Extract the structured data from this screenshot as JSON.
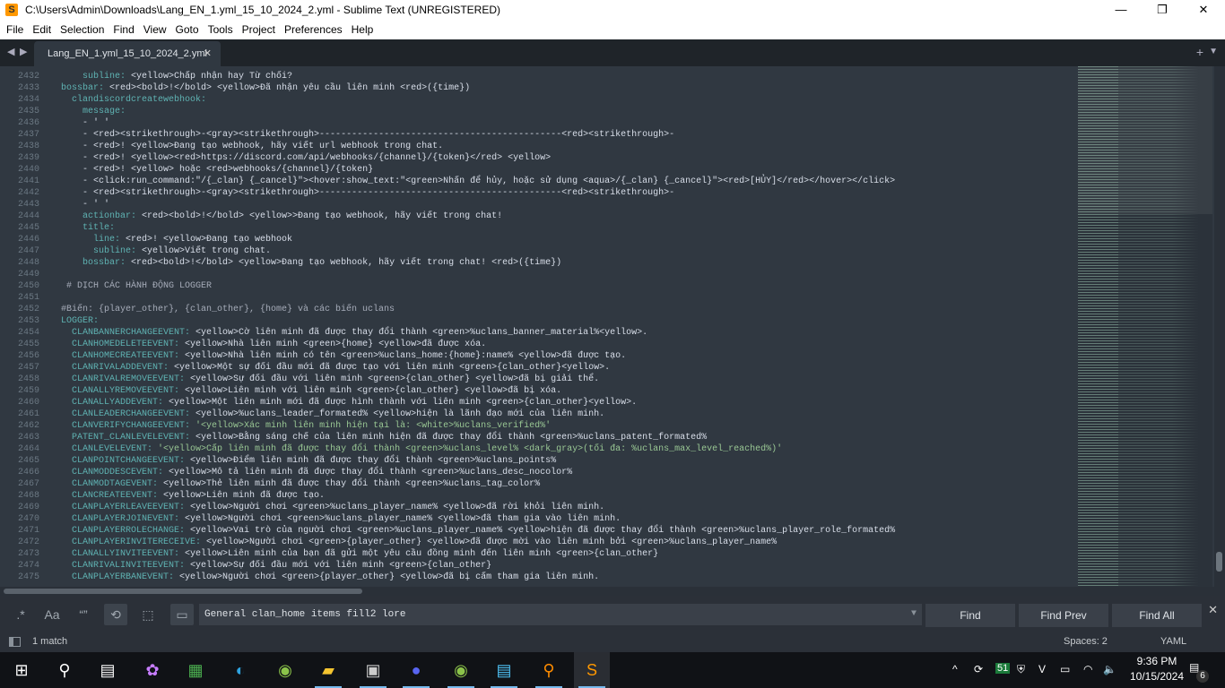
{
  "window": {
    "title": "C:\\Users\\Admin\\Downloads\\Lang_EN_1.yml_15_10_2024_2.yml - Sublime Text (UNREGISTERED)"
  },
  "menu": [
    "File",
    "Edit",
    "Selection",
    "Find",
    "View",
    "Goto",
    "Tools",
    "Project",
    "Preferences",
    "Help"
  ],
  "tab": {
    "label": "Lang_EN_1.yml_15_10_2024_2.yml"
  },
  "lines": [
    {
      "n": "2432",
      "i": "    ",
      "k": "subline:",
      "v": " <yellow>Chấp nhận hay Từ chối?"
    },
    {
      "n": "2433",
      "i": "",
      "k": "bossbar:",
      "v": " <red><bold>!</bold> <yellow>Đã nhận yêu cầu liên minh <red>({time})"
    },
    {
      "n": "2434",
      "i": "  ",
      "k": "clandiscordcreatewebhook:",
      "v": ""
    },
    {
      "n": "2435",
      "i": "    ",
      "k": "message:",
      "v": ""
    },
    {
      "n": "2436",
      "i": "    ",
      "k": "",
      "v": "- ' '"
    },
    {
      "n": "2437",
      "i": "    ",
      "k": "",
      "v": "- <red><strikethrough>-<gray><strikethrough>---------------------------------------------<red><strikethrough>-"
    },
    {
      "n": "2438",
      "i": "    ",
      "k": "",
      "v": "- <red>! <yellow>Đang tạo webhook, hãy viết url webhook trong chat."
    },
    {
      "n": "2439",
      "i": "    ",
      "k": "",
      "v": "- <red>! <yellow><red>https://discord.com/api/webhooks/{channel}/{token}</red> <yellow>"
    },
    {
      "n": "2440",
      "i": "    ",
      "k": "",
      "v": "- <red>! <yellow> hoặc <red>webhooks/{channel}/{token}"
    },
    {
      "n": "2441",
      "i": "    ",
      "k": "",
      "v": "- <click:run_command:\"/{_clan} {_cancel}\"><hover:show_text:\"<green>Nhấn để hủy, hoặc sử dụng <aqua>/{_clan} {_cancel}\"><red>[HỦY]</red></hover></click>"
    },
    {
      "n": "2442",
      "i": "    ",
      "k": "",
      "v": "- <red><strikethrough>-<gray><strikethrough>---------------------------------------------<red><strikethrough>-"
    },
    {
      "n": "2443",
      "i": "    ",
      "k": "",
      "v": "- ' '"
    },
    {
      "n": "2444",
      "i": "    ",
      "k": "actionbar:",
      "v": " <red><bold>!</bold> <yellow>>Đang tạo webhook, hãy viết trong chat!"
    },
    {
      "n": "2445",
      "i": "    ",
      "k": "title:",
      "v": ""
    },
    {
      "n": "2446",
      "i": "      ",
      "k": "line:",
      "v": " <red>! <yellow>Đang tạo webhook"
    },
    {
      "n": "2447",
      "i": "      ",
      "k": "subline:",
      "v": " <yellow>Viết trong chat."
    },
    {
      "n": "2448",
      "i": "    ",
      "k": "bossbar:",
      "v": " <red><bold>!</bold> <yellow>Đang tạo webhook, hãy viết trong chat! <red>({time})"
    },
    {
      "n": "2449",
      "i": "",
      "k": "",
      "v": ""
    },
    {
      "n": "2450",
      "i": " ",
      "k": "",
      "v": "",
      "c": "# DỊCH CÁC HÀNH ĐỘNG LOGGER"
    },
    {
      "n": "2451",
      "i": "",
      "k": "",
      "v": ""
    },
    {
      "n": "2452",
      "i": "",
      "k": "",
      "v": "",
      "c": "#Biến: {player_other}, {clan_other}, {home} và các biến uclans"
    },
    {
      "n": "2453",
      "i": "",
      "k": "LOGGER:",
      "v": ""
    },
    {
      "n": "2454",
      "i": "  ",
      "k": "CLANBANNERCHANGEEVENT:",
      "v": " <yellow>Cờ liên minh đã được thay đổi thành <green>%uclans_banner_material%<yellow>."
    },
    {
      "n": "2455",
      "i": "  ",
      "k": "CLANHOMEDELETEEVENT:",
      "v": " <yellow>Nhà liên minh <green>{home} <yellow>đã được xóa."
    },
    {
      "n": "2456",
      "i": "  ",
      "k": "CLANHOMECREATEEVENT:",
      "v": " <yellow>Nhà liên minh có tên <green>%uclans_home:{home}:name% <yellow>đã được tạo."
    },
    {
      "n": "2457",
      "i": "  ",
      "k": "CLANRIVALADDEVENT:",
      "v": " <yellow>Một sự đối đầu mới đã được tạo với liên minh <green>{clan_other}<yellow>."
    },
    {
      "n": "2458",
      "i": "  ",
      "k": "CLANRIVALREMOVEEVENT:",
      "v": " <yellow>Sự đối đầu với liên minh <green>{clan_other} <yellow>đã bị giải thể."
    },
    {
      "n": "2459",
      "i": "  ",
      "k": "CLANALLYREMOVEEVENT:",
      "v": " <yellow>Liên minh với liên minh <green>{clan_other} <yellow>đã bị xóa."
    },
    {
      "n": "2460",
      "i": "  ",
      "k": "CLANALLYADDEVENT:",
      "v": " <yellow>Một liên minh mới đã được hình thành với liên minh <green>{clan_other}<yellow>."
    },
    {
      "n": "2461",
      "i": "  ",
      "k": "CLANLEADERCHANGEEVENT:",
      "v": " <yellow>%uclans_leader_formated% <yellow>hiện là lãnh đạo mới của liên minh."
    },
    {
      "n": "2462",
      "i": "  ",
      "k": "CLANVERIFYCHANGEEVENT:",
      "v": "",
      "s": " '<yellow>Xác minh liên minh hiện tại là: <white>%uclans_verified%'"
    },
    {
      "n": "2463",
      "i": "  ",
      "k": "PATENT_CLANLEVELEVENT:",
      "v": " <yellow>Bằng sáng chế của liên minh hiện đã được thay đổi thành <green>%uclans_patent_formated%"
    },
    {
      "n": "2464",
      "i": "  ",
      "k": "CLANLEVELEVENT:",
      "v": "",
      "s": " '<yellow>Cấp liên minh đã được thay đổi thành <green>%uclans_level% <dark_gray>(tối đa: %uclans_max_level_reached%)'"
    },
    {
      "n": "2465",
      "i": "  ",
      "k": "CLANPOINTCHANGEEVENT:",
      "v": " <yellow>Điểm liên minh đã được thay đổi thành <green>%uclans_points%"
    },
    {
      "n": "2466",
      "i": "  ",
      "k": "CLANMODDESCEVENT:",
      "v": " <yellow>Mô tả liên minh đã được thay đổi thành <green>%uclans_desc_nocolor%"
    },
    {
      "n": "2467",
      "i": "  ",
      "k": "CLANMODTAGEVENT:",
      "v": " <yellow>Thẻ liên minh đã được thay đổi thành <green>%uclans_tag_color%"
    },
    {
      "n": "2468",
      "i": "  ",
      "k": "CLANCREATEEVENT:",
      "v": " <yellow>Liên minh đã được tạo."
    },
    {
      "n": "2469",
      "i": "  ",
      "k": "CLANPLAYERLEAVEEVENT:",
      "v": " <yellow>Người chơi <green>%uclans_player_name% <yellow>đã rời khỏi liên minh."
    },
    {
      "n": "2470",
      "i": "  ",
      "k": "CLANPLAYERJOINEVENT:",
      "v": " <yellow>Người chơi <green>%uclans_player_name% <yellow>đã tham gia vào liên minh."
    },
    {
      "n": "2471",
      "i": "  ",
      "k": "CLANPLAYERROLECHANGE:",
      "v": " <yellow>Vai trò của người chơi <green>%uclans_player_name% <yellow>hiện đã được thay đổi thành <green>%uclans_player_role_formated%"
    },
    {
      "n": "2472",
      "i": "  ",
      "k": "CLANPLAYERINVITERECEIVE:",
      "v": " <yellow>Người chơi <green>{player_other} <yellow>đã được mời vào liên minh bởi <green>%uclans_player_name%"
    },
    {
      "n": "2473",
      "i": "  ",
      "k": "CLANALLYINVITEEVENT:",
      "v": " <yellow>Liên minh của bạn đã gửi một yêu cầu đồng minh đến liên minh <green>{clan_other}"
    },
    {
      "n": "2474",
      "i": "  ",
      "k": "CLANRIVALINVITEEVENT:",
      "v": " <yellow>Sự đối đầu mới với liên minh <green>{clan_other}"
    },
    {
      "n": "2475",
      "i": "  ",
      "k": "CLANPLAYERBANEVENT:",
      "v": " <yellow>Người chơi <green>{player_other} <yellow>đã bị cấm tham gia liên minh."
    }
  ],
  "find": {
    "value": "General clan_home items fill2 lore",
    "regex": ".*",
    "case": "Aa",
    "word": "“”",
    "wrap": "wrap",
    "insel": "in-selection",
    "highlight": "highlight",
    "find": "Find",
    "find_prev": "Find Prev",
    "find_all": "Find All"
  },
  "status": {
    "matches": "1 match",
    "spaces": "Spaces: 2",
    "syntax": "YAML"
  },
  "taskbar": {
    "time": "9:36 PM",
    "date": "10/15/2024",
    "notifications": "6",
    "tray_badge": "51"
  },
  "colors": {
    "editor_bg": "#303841",
    "key": "#5fb3b3",
    "string": "#99c794",
    "text": "#d8dee9",
    "accent": "#ff9800"
  }
}
